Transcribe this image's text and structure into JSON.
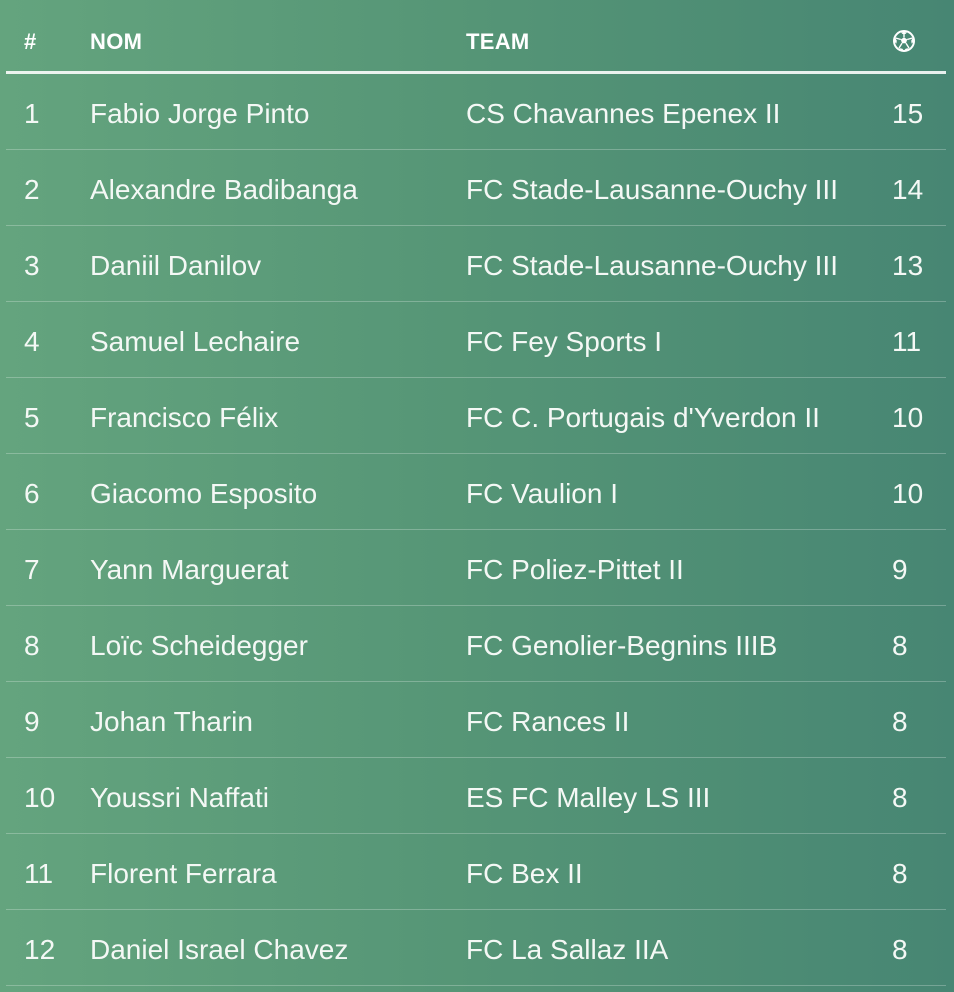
{
  "header": {
    "rank_label": "#",
    "name_label": "NOM",
    "team_label": "TEAM",
    "goals_icon": "soccer-ball-icon"
  },
  "rows": [
    {
      "rank": "1",
      "name": "Fabio Jorge Pinto",
      "team": "CS Chavannes Epenex II",
      "goals": "15"
    },
    {
      "rank": "2",
      "name": "Alexandre Badibanga",
      "team": "FC Stade-Lausanne-Ouchy III",
      "goals": "14"
    },
    {
      "rank": "3",
      "name": "Daniil Danilov",
      "team": "FC Stade-Lausanne-Ouchy III",
      "goals": "13"
    },
    {
      "rank": "4",
      "name": "Samuel Lechaire",
      "team": "FC Fey Sports I",
      "goals": "11"
    },
    {
      "rank": "5",
      "name": "Francisco Félix",
      "team": "FC C. Portugais d'Yverdon II",
      "goals": "10"
    },
    {
      "rank": "6",
      "name": "Giacomo Esposito",
      "team": "FC Vaulion I",
      "goals": "10"
    },
    {
      "rank": "7",
      "name": "Yann Marguerat",
      "team": "FC Poliez-Pittet II",
      "goals": "9"
    },
    {
      "rank": "8",
      "name": "Loïc Scheidegger",
      "team": "FC Genolier-Begnins IIIB",
      "goals": "8"
    },
    {
      "rank": "9",
      "name": "Johan Tharin",
      "team": "FC Rances II",
      "goals": "8"
    },
    {
      "rank": "10",
      "name": "Youssri Naffati",
      "team": "ES FC Malley LS III",
      "goals": "8"
    },
    {
      "rank": "11",
      "name": "Florent Ferrara",
      "team": "FC Bex II",
      "goals": "8"
    },
    {
      "rank": "12",
      "name": "Daniel Israel Chavez",
      "team": "FC La Sallaz IIA",
      "goals": "8"
    }
  ]
}
